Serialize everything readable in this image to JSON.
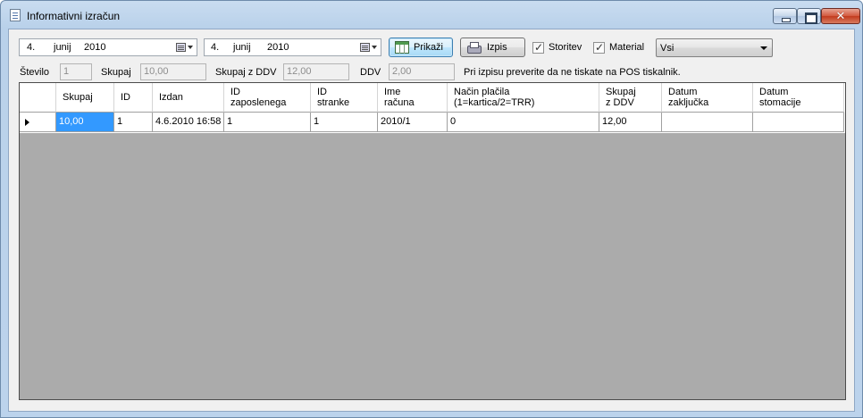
{
  "window": {
    "title": "Informativni izračun",
    "minimize_icon": "minimize-icon",
    "maximize_icon": "maximize-icon",
    "close_glyph": "✕"
  },
  "toolbar": {
    "date_from": {
      "day": "4.",
      "month": "junij",
      "year": "2010"
    },
    "date_to": {
      "day": "4.",
      "month": "junij",
      "year": "2010"
    },
    "show_button": "Prikaži",
    "print_button": "Izpis",
    "checkbox_services": {
      "label": "Storitev",
      "checked": true
    },
    "checkbox_material": {
      "label": "Material",
      "checked": true
    },
    "filter_select": {
      "value": "Vsi"
    }
  },
  "summary": {
    "count_label": "Število",
    "count_value": "1",
    "total_label": "Skupaj",
    "total_value": "10,00",
    "total_vat_label": "Skupaj z DDV",
    "total_vat_value": "12,00",
    "vat_label": "DDV",
    "vat_value": "2,00",
    "notice": "Pri izpisu preverite da ne tiskate na POS tiskalnik."
  },
  "grid": {
    "columns": [
      {
        "line1": "Skupaj",
        "line2": ""
      },
      {
        "line1": "ID",
        "line2": ""
      },
      {
        "line1": "Izdan",
        "line2": ""
      },
      {
        "line1": "ID",
        "line2": "zaposlenega"
      },
      {
        "line1": "ID",
        "line2": "stranke"
      },
      {
        "line1": "Ime",
        "line2": "računa"
      },
      {
        "line1": "Način plačila",
        "line2": "(1=kartica/2=TRR)"
      },
      {
        "line1": "Skupaj",
        "line2": "z DDV"
      },
      {
        "line1": "Datum",
        "line2": "zaključka"
      },
      {
        "line1": "Datum",
        "line2": "stomacije"
      }
    ],
    "rows": [
      [
        "10,00",
        "1",
        "4.6.2010 16:58",
        "1",
        "1",
        "2010/1",
        "0",
        "12,00",
        "",
        ""
      ]
    ],
    "selection_color": "#3399ff",
    "empty_area_color": "#ababab"
  }
}
